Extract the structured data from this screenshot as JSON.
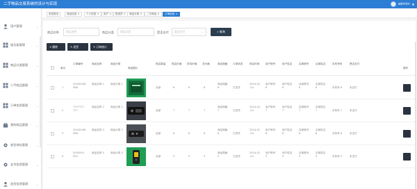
{
  "app": {
    "title": "二手物品交易系统的设计与实现",
    "user": "admin"
  },
  "sidebar": {
    "items": [
      {
        "label": "用户管理",
        "icon": "user-icon"
      },
      {
        "label": "留言板管理",
        "icon": "grid-icon"
      },
      {
        "label": "商品分类管理",
        "icon": "grid-icon"
      },
      {
        "label": "二手商品管理",
        "icon": "grid-icon"
      },
      {
        "label": "订单信息管理",
        "icon": "grid-icon"
      },
      {
        "label": "我的商品管理",
        "icon": "bag-icon"
      },
      {
        "label": "收货地址管理",
        "icon": "gear-icon"
      },
      {
        "label": "支付信息管理",
        "icon": "gear-icon"
      },
      {
        "label": "退货信息管理",
        "icon": "user-icon"
      }
    ]
  },
  "tabs": [
    {
      "label": "系统首页"
    },
    {
      "label": "商品信息 ×"
    },
    {
      "label": "个人信息 ×"
    },
    {
      "label": "用户 ×"
    },
    {
      "label": "配送员 ×"
    },
    {
      "label": "商品分类 ×"
    },
    {
      "label": "二手商品 ×"
    },
    {
      "label": "订单信息 ×"
    }
  ],
  "filters": {
    "product_name_label": "商品名称",
    "product_name_placeholder": "商品名称",
    "product_category_label": "商品分类",
    "product_category_placeholder": "商品分类",
    "paid_label": "是否支付",
    "paid_placeholder": "是否支付",
    "search_label": "查询"
  },
  "actions": {
    "delete": "删除",
    "ship": "发货",
    "stats": "订单统计"
  },
  "table": {
    "headers": [
      "索引",
      "订单编号",
      "商品名称",
      "商品分类",
      "商品图片",
      "购买数量",
      "购买价格",
      "折扣价格",
      "总价格",
      "商品规格",
      "订单状态",
      "购买时间",
      "用户账号",
      "用户姓名",
      "买家账号",
      "买家姓名",
      "手机号码",
      "是否支付",
      "操作"
    ],
    "rows": [
      {
        "index": "1",
        "order_no": "20240308 088",
        "name": "商品名称 1",
        "category": "商品分类 1",
        "image": "box-device",
        "qty": "全部",
        "price": "6",
        "discount": "6",
        "total": "6",
        "spec": "商品规格 6",
        "status": "已发货",
        "time": "2024-02 -24",
        "user_acct": "用户账号 6",
        "user_name": "用户姓名 6",
        "buyer_acct": "买家账号 6",
        "buyer_name": "买家姓名 6",
        "phone": "手机号 6",
        "paid": "未支付"
      },
      {
        "index": "2",
        "order_no": "7777777 777",
        "name": "商品名称 2",
        "category": "商品分类 2",
        "image": "remote-control",
        "qty": "全部",
        "price": "7",
        "discount": "7",
        "total": "7",
        "spec": "商品规格 7",
        "status": "已发货",
        "time": "2024-02 -24",
        "user_acct": "用户账号 7",
        "user_name": "用户姓名 7",
        "buyer_acct": "买家账号 7",
        "buyer_name": "买家姓名 7",
        "phone": "手机号 7",
        "paid": "未支付"
      },
      {
        "index": "3",
        "order_no": "20240308 088",
        "name": "商品名称 3",
        "category": "商品分类 3",
        "image": "remote-control",
        "qty": "全部",
        "price": "8",
        "discount": "8",
        "total": "8",
        "spec": "商品规格 8",
        "status": "已发货",
        "time": "2024-02 -24",
        "user_acct": "用户账号 8",
        "user_name": "用户姓名 8",
        "buyer_acct": "买家账号 8",
        "buyer_name": "买家姓名 8",
        "phone": "手机号 8",
        "paid": "未支付"
      },
      {
        "index": "4",
        "order_no": "5555555 555",
        "name": "商品名称 5",
        "category": "商品分类 5",
        "image": "phone",
        "qty": "全部",
        "price": "5",
        "discount": "5",
        "total": "5",
        "spec": "商品规格 5",
        "status": "已发货",
        "time": "2024-02 -24",
        "user_acct": "用户账号 5",
        "user_name": "用户姓名 5",
        "buyer_acct": "买家账号 5",
        "buyer_name": "买家姓名 5",
        "phone": "手机号 5",
        "paid": "未支付"
      }
    ]
  },
  "colors": {
    "topbar": "#2c7dd4",
    "dark_button": "#2b3340",
    "image_green": "#1f9d55"
  }
}
